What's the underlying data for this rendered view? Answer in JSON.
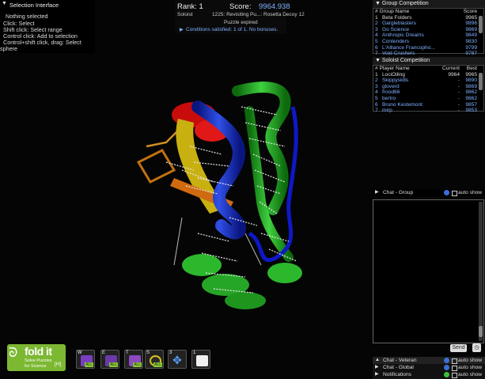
{
  "selection": {
    "title": "Selection Interface",
    "lines": [
      "Nothing selected",
      "Click: Select",
      "Shift click: Select range",
      "Control click: Add to selection",
      "Control+shift click, drag: Select",
      "sphere"
    ]
  },
  "score": {
    "rank_label": "Rank: 1",
    "score_label": "Score:",
    "score_value": "9964.938",
    "mode": "Soloist",
    "puzzle": "1225: Revisiting Pu...: Rosetta Decoy 12",
    "status": "Puzzle expired",
    "conditions": "Conditions satisfied: 1 of 1. No bonuses."
  },
  "group_comp": {
    "title": "Group Competition",
    "col_name": "# Group Name",
    "col_score": "Score",
    "rows": [
      {
        "num": "1",
        "name": "Beta Folders",
        "score": "9965"
      },
      {
        "num": "2",
        "name": "Gargleblasters",
        "score": "9896"
      },
      {
        "num": "3",
        "name": "Go Science",
        "score": "9869"
      },
      {
        "num": "4",
        "name": "Anthropic Dreams",
        "score": "9849"
      },
      {
        "num": "5",
        "name": "Contenders",
        "score": "9830"
      },
      {
        "num": "6",
        "name": "L'Alliance Francopho...",
        "score": "9799"
      },
      {
        "num": "7",
        "name": "Void Crushers",
        "score": "9787"
      }
    ]
  },
  "solo_comp": {
    "title": "Soloist Competition",
    "col_name": "# Player Name",
    "col_current": "Current",
    "col_best": "Best",
    "rows": [
      {
        "num": "1",
        "name": "LociOiling",
        "current": "9964",
        "best": "9965"
      },
      {
        "num": "2",
        "name": "Skippysk8s",
        "current": "-",
        "best": "9890"
      },
      {
        "num": "3",
        "name": "gloverd",
        "current": "-",
        "best": "9869"
      },
      {
        "num": "4",
        "name": "frood66",
        "current": "-",
        "best": "9862"
      },
      {
        "num": "5",
        "name": "bertro",
        "current": "-",
        "best": "9862"
      },
      {
        "num": "6",
        "name": "Bruno Kestemont",
        "current": "-",
        "best": "9857"
      },
      {
        "num": "7",
        "name": "mirp",
        "current": "-",
        "best": "9853"
      }
    ]
  },
  "chat": {
    "group_label": "Chat - Group",
    "auto_show": "auto show",
    "send": "Send",
    "tabs": [
      {
        "label": "Chat - Veteran"
      },
      {
        "label": "Chat - Global"
      },
      {
        "label": "Notifications"
      }
    ]
  },
  "logo": {
    "name": "fold it",
    "tagline1": "Solve Puzzles",
    "tagline2": "for Science",
    "badge": "[H]"
  },
  "tools": [
    {
      "key": "W",
      "icon": "wiggle-icon"
    },
    {
      "key": "E",
      "icon": "shake-icon"
    },
    {
      "key": "T",
      "icon": "tweak-icon"
    },
    {
      "key": "S",
      "icon": "shake-sidechains-icon"
    },
    {
      "key": "3",
      "icon": "move-icon"
    },
    {
      "key": "1",
      "icon": "notes-icon"
    }
  ],
  "colors": {
    "accent_blue": "#7fb0ff",
    "helix_red": "#d01010",
    "strand_green": "#1ea41e",
    "coil_blue": "#1020c0"
  }
}
